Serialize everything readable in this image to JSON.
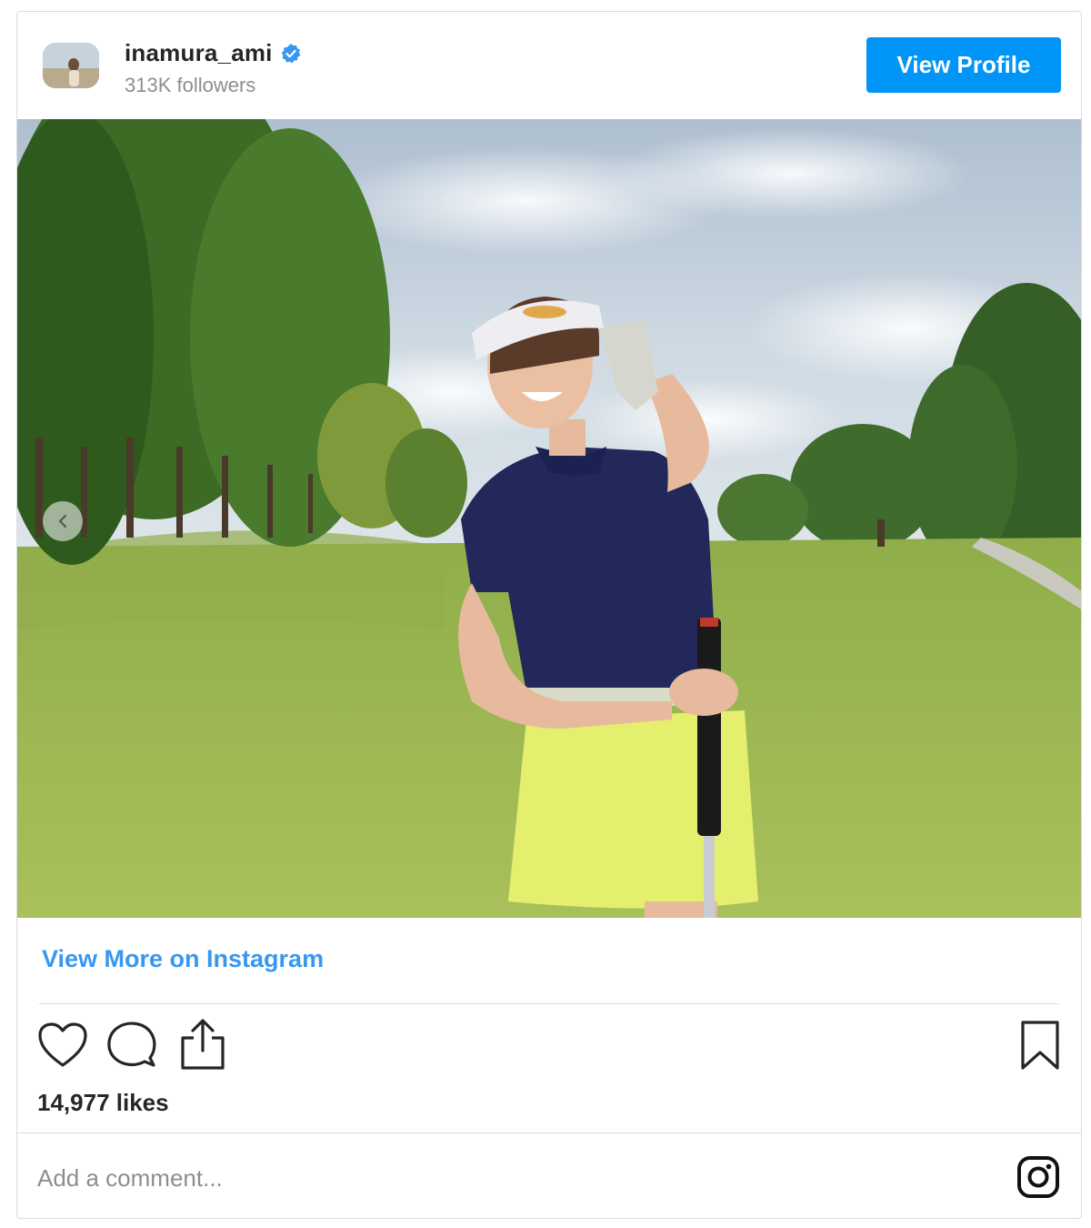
{
  "header": {
    "username": "inamura_ami",
    "followers": "313K followers",
    "verified": true,
    "view_profile_label": "View Profile"
  },
  "post": {
    "view_more_label": "View More on Instagram",
    "likes": "14,977 likes",
    "comment_placeholder": "Add a comment..."
  },
  "icons": {
    "verified": "verified-badge-icon",
    "carousel_prev": "chevron-left-icon",
    "like": "heart-icon",
    "comment": "comment-icon",
    "share": "share-icon",
    "save": "bookmark-icon",
    "brand": "instagram-icon"
  },
  "colors": {
    "accent": "#0095f6",
    "link": "#3897f0",
    "text": "#262626",
    "muted": "#8e8e8e",
    "border": "#dbdbdb"
  }
}
